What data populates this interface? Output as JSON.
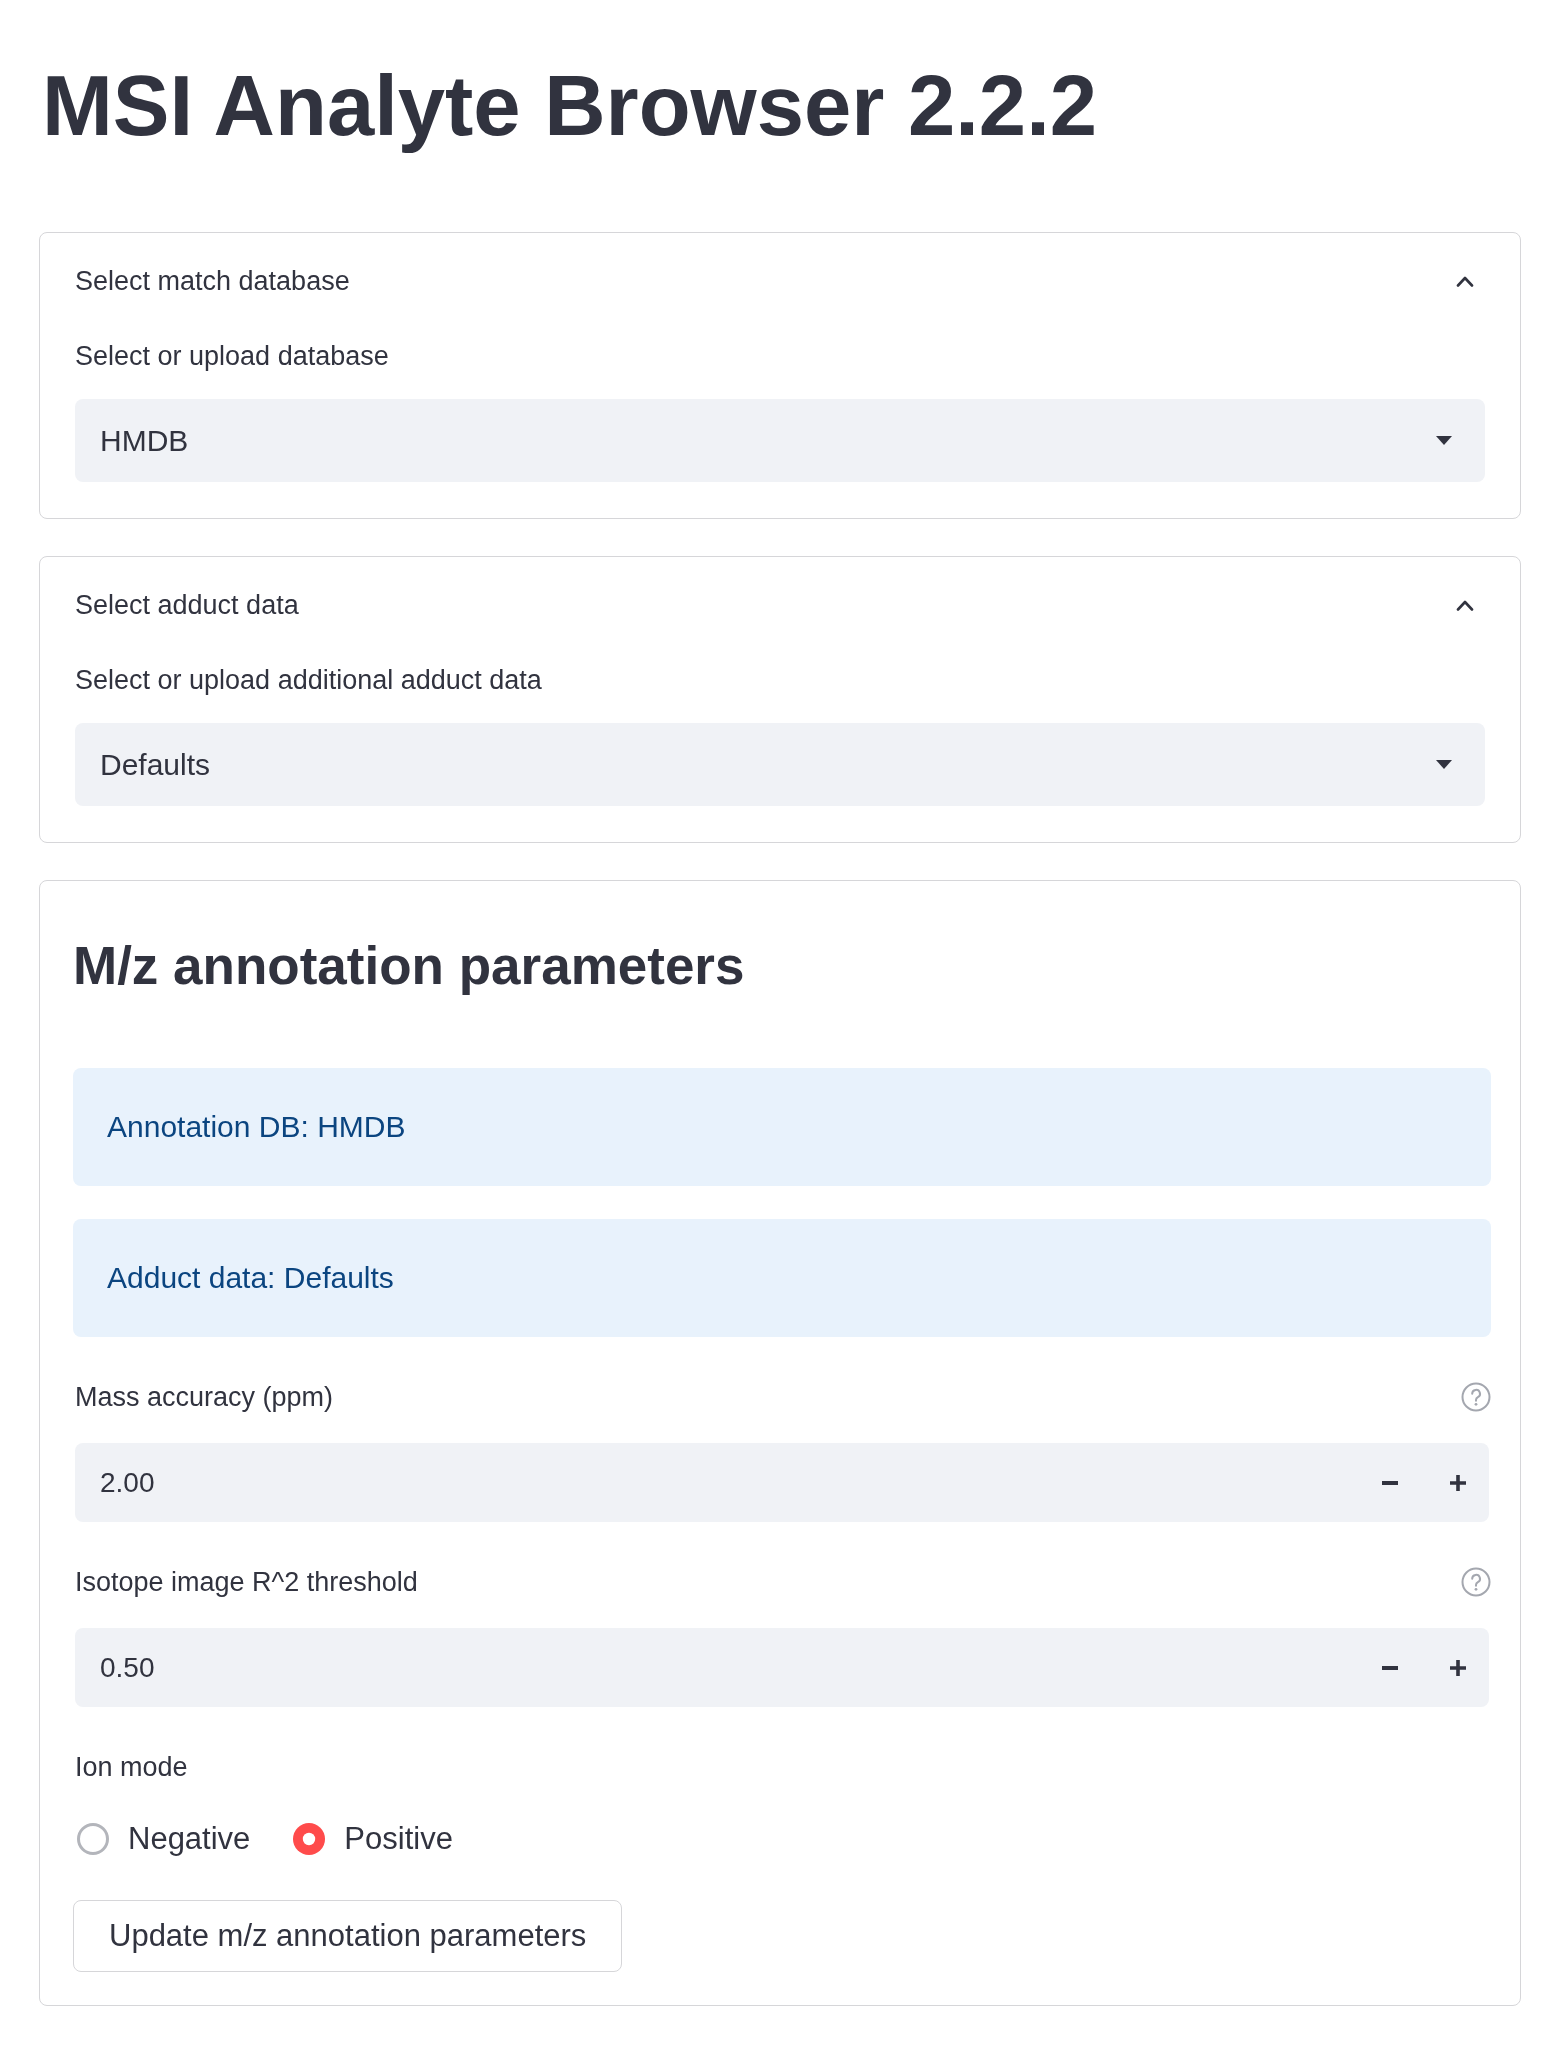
{
  "title": "MSI Analyte Browser 2.2.2",
  "expanders": [
    {
      "header": "Select match database",
      "expanded": true,
      "field": {
        "label": "Select or upload database",
        "value": "HMDB"
      }
    },
    {
      "header": "Select adduct data",
      "expanded": true,
      "field": {
        "label": "Select or upload additional adduct data",
        "value": "Defaults"
      }
    }
  ],
  "parameters": {
    "heading": "M/z annotation parameters",
    "info": [
      "Annotation DB: HMDB",
      "Adduct data: Defaults"
    ],
    "number_inputs": [
      {
        "label": "Mass accuracy (ppm)",
        "value": "2.00"
      },
      {
        "label": "Isotope image R^2 threshold",
        "value": "0.50"
      }
    ],
    "ion_mode": {
      "label": "Ion mode",
      "options": [
        {
          "label": "Negative",
          "selected": false
        },
        {
          "label": "Positive",
          "selected": true
        }
      ]
    },
    "button": "Update m/z annotation parameters"
  }
}
